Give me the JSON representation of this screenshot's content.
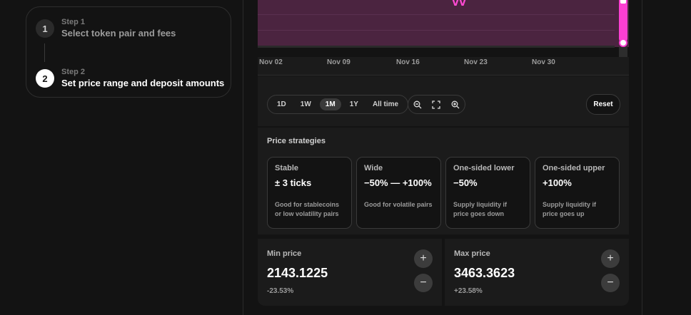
{
  "steps": [
    {
      "number": "1",
      "label": "Step 1",
      "title": "Select token pair and fees",
      "active": false
    },
    {
      "number": "2",
      "label": "Step 2",
      "title": "Set price range and deposit amounts",
      "active": true
    }
  ],
  "chart": {
    "x_ticks": [
      "Nov 02",
      "Nov 09",
      "Nov 16",
      "Nov 23",
      "Nov 30"
    ],
    "band_color": "#4b2440",
    "handle_color": "#fc3fd2"
  },
  "timeframes": [
    "1D",
    "1W",
    "1M",
    "1Y",
    "All time"
  ],
  "selected_timeframe": "1M",
  "zoom": {
    "zoom_out_icon": "zoom-out-icon",
    "fit_icon": "fit-screen-icon",
    "zoom_in_icon": "zoom-in-icon"
  },
  "reset_label": "Reset",
  "strategies": {
    "title": "Price strategies",
    "items": [
      {
        "name": "Stable",
        "value": "± 3 ticks",
        "description": "Good for stablecoins or low volatility pairs"
      },
      {
        "name": "Wide",
        "value": "−50% — +100%",
        "description": "Good for volatile pairs"
      },
      {
        "name": "One-sided lower",
        "value": "−50%",
        "description": "Supply liquidity if price goes down"
      },
      {
        "name": "One-sided upper",
        "value": "+100%",
        "description": "Supply liquidity if price goes up"
      }
    ]
  },
  "min_price": {
    "label": "Min price",
    "value": "2143.1225",
    "delta": "-23.53%"
  },
  "max_price": {
    "label": "Max price",
    "value": "3463.3623",
    "delta": "+23.58%"
  },
  "stepper": {
    "plus": "+",
    "minus": "−"
  }
}
